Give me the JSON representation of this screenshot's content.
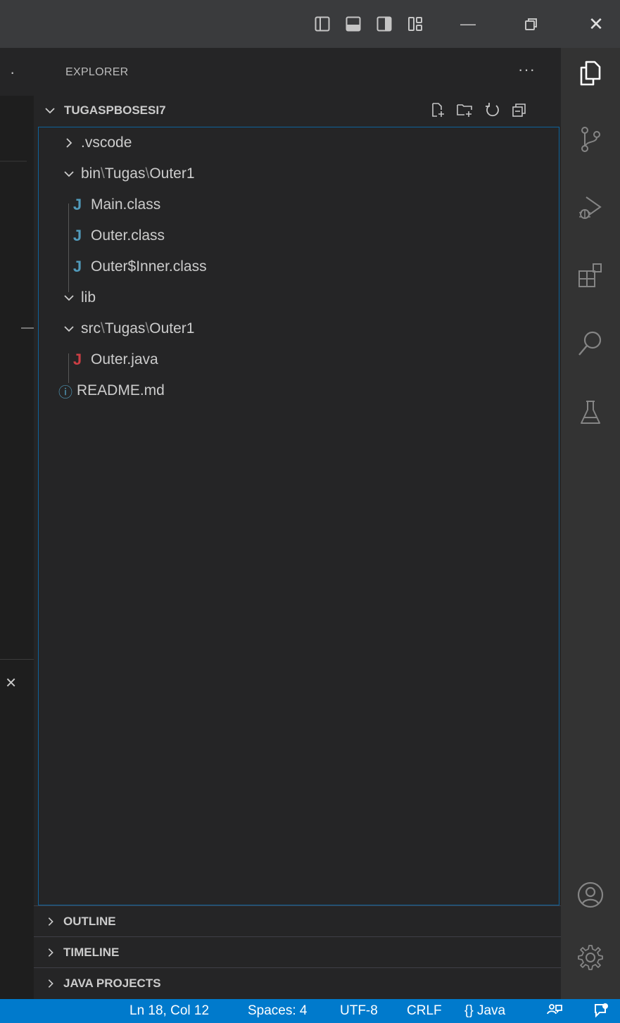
{
  "window": {
    "controls": {
      "toggle_primary_sidebar": "layout-sidebar-left-icon",
      "toggle_panel": "layout-panel-icon",
      "toggle_secondary_sidebar": "layout-sidebar-right-icon",
      "customize_layout": "layout-customize-icon",
      "minimize": "—",
      "restore": "restore-icon",
      "close": "✕"
    }
  },
  "editor": {
    "more_actions": "·",
    "panel_close": "×"
  },
  "explorer": {
    "title": "EXPLORER",
    "more": "···",
    "folder_name": "TUGASPBOSESI7",
    "actions": [
      "new-file-icon",
      "new-folder-icon",
      "refresh-icon",
      "collapse-all-icon"
    ],
    "tree": [
      {
        "type": "folder",
        "expanded": false,
        "parts": [
          ".vscode"
        ]
      },
      {
        "type": "folder",
        "expanded": true,
        "parts": [
          "bin",
          "Tugas",
          "Outer1"
        ]
      },
      {
        "type": "file",
        "icon": "J",
        "icon_color": "#519aba",
        "name": "Main.class"
      },
      {
        "type": "file",
        "icon": "J",
        "icon_color": "#519aba",
        "name": "Outer.class"
      },
      {
        "type": "file",
        "icon": "J",
        "icon_color": "#519aba",
        "name": "Outer$Inner.class"
      },
      {
        "type": "folder",
        "expanded": true,
        "parts": [
          "lib"
        ]
      },
      {
        "type": "folder",
        "expanded": true,
        "parts": [
          "src",
          "Tugas",
          "Outer1"
        ]
      },
      {
        "type": "file",
        "icon": "J",
        "icon_color": "#cc3e44",
        "name": "Outer.java"
      },
      {
        "type": "file",
        "icon": "ⓘ",
        "icon_color": "#519aba",
        "name": "README.md"
      }
    ],
    "sections": [
      "OUTLINE",
      "TIMELINE",
      "JAVA PROJECTS"
    ]
  },
  "activity_bar": {
    "items": [
      "explorer-icon",
      "source-control-icon",
      "run-debug-icon",
      "extensions-icon",
      "search-icon",
      "testing-icon"
    ],
    "bottom": [
      "accounts-icon",
      "manage-gear-icon"
    ]
  },
  "status_bar": {
    "position": "Ln 18, Col 12",
    "indent": "Spaces: 4",
    "encoding": "UTF-8",
    "eol": "CRLF",
    "language_braces": "{}",
    "language": "Java",
    "feedback": "feedback-icon",
    "notifications": "notifications-icon"
  },
  "colors": {
    "accent": "#007acc",
    "sidebar_bg": "#252526",
    "activity_bg": "#333333",
    "titlebar_bg": "#3a3b3d",
    "focus_border": "#0e639c"
  }
}
